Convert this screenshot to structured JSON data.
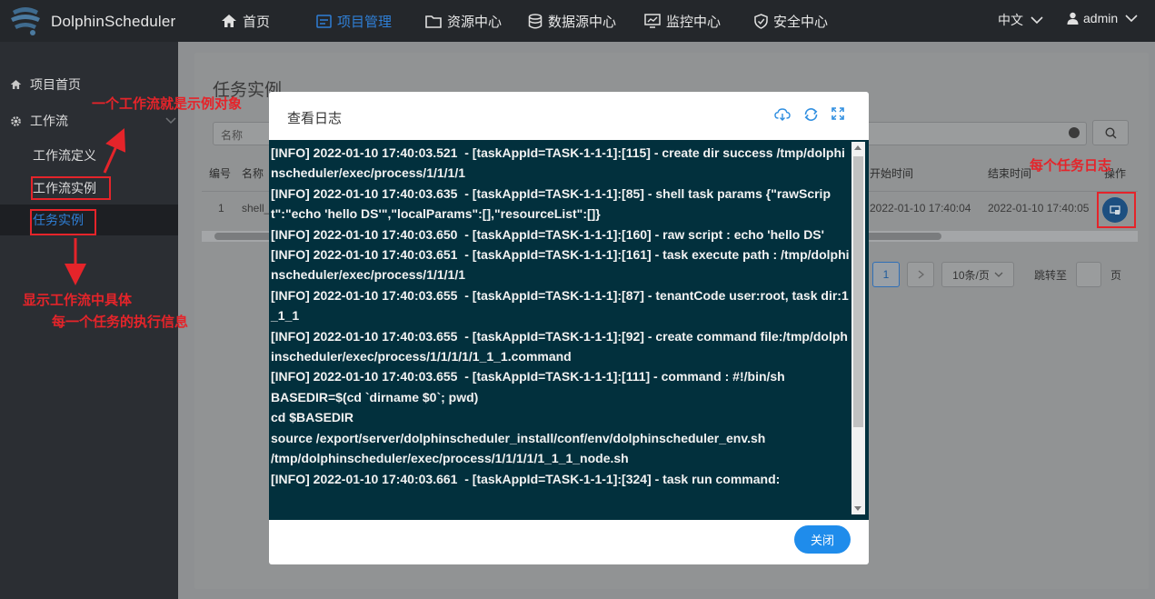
{
  "header": {
    "brand": "DolphinScheduler",
    "nav": [
      {
        "label": "首页",
        "icon": "home-icon"
      },
      {
        "label": "项目管理",
        "icon": "project-icon"
      },
      {
        "label": "资源中心",
        "icon": "folder-icon"
      },
      {
        "label": "数据源中心",
        "icon": "database-icon"
      },
      {
        "label": "监控中心",
        "icon": "monitor-icon"
      },
      {
        "label": "安全中心",
        "icon": "shield-icon"
      }
    ],
    "language": "中文",
    "user": "admin"
  },
  "sidebar": {
    "project_home": "项目首页",
    "workflow": "工作流",
    "workflow_definition": "工作流定义",
    "workflow_instance": "工作流实例",
    "task_instance": "任务实例"
  },
  "main": {
    "title": "任务实例",
    "search_placeholder": "名称",
    "columns": [
      "编号",
      "名称",
      "开始时间",
      "结束时间",
      "操作"
    ],
    "row": {
      "id": "1",
      "name": "shell_",
      "start": "2022-01-10 17:40:04",
      "end": "2022-01-10 17:40:05"
    },
    "pager": {
      "current": "1",
      "page_size": "10条/页",
      "jump_label": "跳转至",
      "page_unit": "页"
    }
  },
  "modal": {
    "title": "查看日志",
    "close_label": "关闭",
    "log": "[INFO] 2022-01-10 17:40:03.521  - [taskAppId=TASK-1-1-1]:[115] - create dir success /tmp/dolphinscheduler/exec/process/1/1/1/1\n[INFO] 2022-01-10 17:40:03.635  - [taskAppId=TASK-1-1-1]:[85] - shell task params {\"rawScript\":\"echo 'hello DS'\",\"localParams\":[],\"resourceList\":[]}\n[INFO] 2022-01-10 17:40:03.650  - [taskAppId=TASK-1-1-1]:[160] - raw script : echo 'hello DS'\n[INFO] 2022-01-10 17:40:03.651  - [taskAppId=TASK-1-1-1]:[161] - task execute path : /tmp/dolphinscheduler/exec/process/1/1/1/1\n[INFO] 2022-01-10 17:40:03.655  - [taskAppId=TASK-1-1-1]:[87] - tenantCode user:root, task dir:1_1_1\n[INFO] 2022-01-10 17:40:03.655  - [taskAppId=TASK-1-1-1]:[92] - create command file:/tmp/dolphinscheduler/exec/process/1/1/1/1/1_1_1.command\n[INFO] 2022-01-10 17:40:03.655  - [taskAppId=TASK-1-1-1]:[111] - command : #!/bin/sh\nBASEDIR=$(cd `dirname $0`; pwd)\ncd $BASEDIR\nsource /export/server/dolphinscheduler_install/conf/env/dolphinscheduler_env.sh\n/tmp/dolphinscheduler/exec/process/1/1/1/1/1_1_1_node.sh\n[INFO] 2022-01-10 17:40:03.661  - [taskAppId=TASK-1-1-1]:[324] - task run command:"
  },
  "annotations": {
    "workflow_is_instance": "一个工作流就是示例对象",
    "each_task_log": "每个任务日志",
    "detail_line1": "显示工作流中具体",
    "detail_line2": "每一个任务的执行信息"
  },
  "colors": {
    "accent": "#2f7fd6",
    "log_bg": "#02303d",
    "annotation": "#e5242a",
    "button": "#1f8ceb"
  }
}
